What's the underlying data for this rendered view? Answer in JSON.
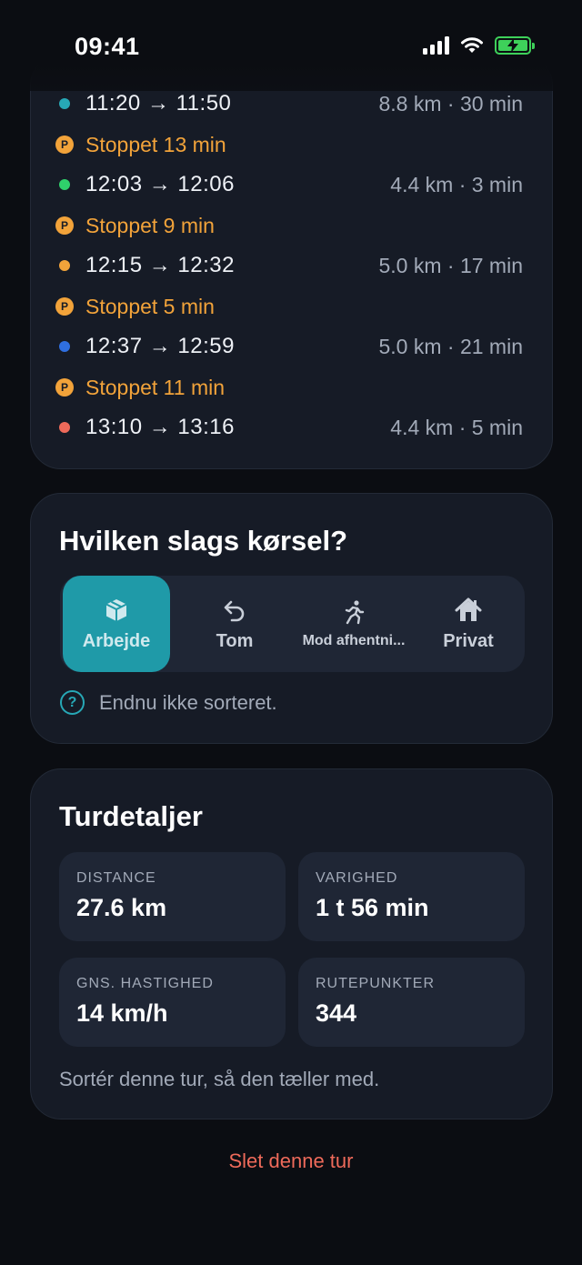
{
  "status_bar": {
    "time": "09:41",
    "battery_color": "#3ed15a"
  },
  "trips": [
    {
      "time": "11:20 → 11:50",
      "meta": "8.8 km · 30 min",
      "color": "#27a8b6"
    },
    {
      "stop": "Stoppet 13 min"
    },
    {
      "time": "12:03 → 12:06",
      "meta": "4.4 km · 3 min",
      "color": "#2fd16b"
    },
    {
      "stop": "Stoppet 9 min"
    },
    {
      "time": "12:15 → 12:32",
      "meta": "5.0 km · 17 min",
      "color": "#f2a33a"
    },
    {
      "stop": "Stoppet 5 min"
    },
    {
      "time": "12:37 → 12:59",
      "meta": "5.0 km · 21 min",
      "color": "#2f6fe0"
    },
    {
      "stop": "Stoppet 11 min"
    },
    {
      "time": "13:10 → 13:16",
      "meta": "4.4 km · 5 min",
      "color": "#ee6a5a"
    }
  ],
  "parking_badge": "P",
  "kind": {
    "title": "Hvilken slags kørsel?",
    "options": [
      {
        "label": "Arbejde",
        "icon": "box-icon",
        "selected": true
      },
      {
        "label": "Tom",
        "icon": "undo-arrow-icon",
        "selected": false
      },
      {
        "label": "Mod afhentni...",
        "icon": "running-person-icon",
        "selected": false
      },
      {
        "label": "Privat",
        "icon": "home-icon",
        "selected": false
      }
    ],
    "hint_icon": "?",
    "hint": "Endnu ikke sorteret."
  },
  "details": {
    "title": "Turdetaljer",
    "stats": [
      {
        "label": "DISTANCE",
        "value": "27.6 km"
      },
      {
        "label": "VARIGHED",
        "value": "1 t 56 min"
      },
      {
        "label": "GNS. HASTIGHED",
        "value": "14 km/h"
      },
      {
        "label": "RUTEPUNKTER",
        "value": "344"
      }
    ],
    "footnote": "Sortér denne tur, så den tæller med."
  },
  "delete_label": "Slet denne tur",
  "colors": {
    "accent": "#1f9aa8",
    "stop": "#f2a33a",
    "danger": "#ee6a5a",
    "card": "#161b26"
  }
}
